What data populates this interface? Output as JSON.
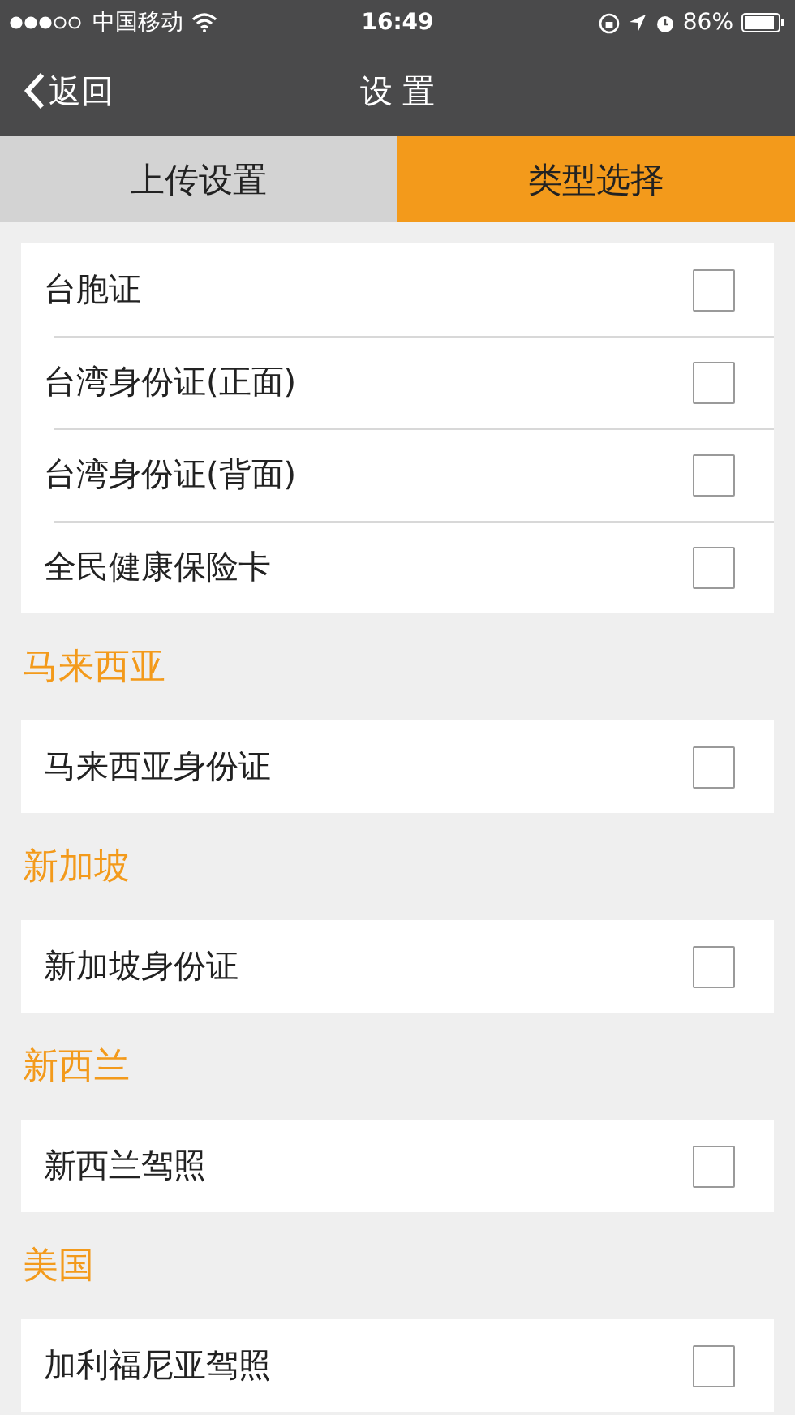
{
  "status_bar": {
    "carrier": "中国移动",
    "time": "16:49",
    "battery": "86%"
  },
  "nav": {
    "back": "返回",
    "title": "设 置"
  },
  "tabs": [
    {
      "label": "上传设置",
      "selected": false
    },
    {
      "label": "类型选择",
      "selected": true
    }
  ],
  "sections": [
    {
      "items": [
        {
          "label": "台胞证",
          "checked": false
        },
        {
          "label": "台湾身份证(正面)",
          "checked": false
        },
        {
          "label": "台湾身份证(背面)",
          "checked": false
        },
        {
          "label": "全民健康保险卡",
          "checked": false
        }
      ]
    },
    {
      "title": "马来西亚",
      "items": [
        {
          "label": "马来西亚身份证",
          "checked": false
        }
      ]
    },
    {
      "title": "新加坡",
      "items": [
        {
          "label": "新加坡身份证",
          "checked": false
        }
      ]
    },
    {
      "title": "新西兰",
      "items": [
        {
          "label": "新西兰驾照",
          "checked": false
        }
      ]
    },
    {
      "title": "美国",
      "items": [
        {
          "label": "加利福尼亚驾照",
          "checked": false
        }
      ]
    }
  ]
}
